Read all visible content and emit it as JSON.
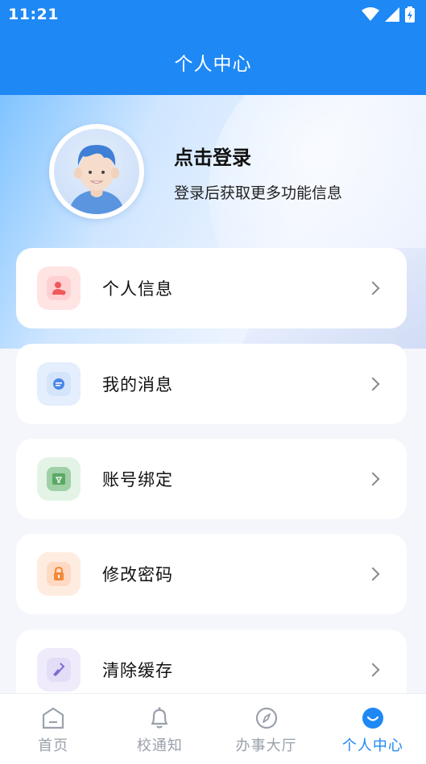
{
  "status_bar": {
    "time": "11:21"
  },
  "header": {
    "title": "个人中心"
  },
  "profile": {
    "login_title": "点击登录",
    "login_subtitle": "登录后获取更多功能信息"
  },
  "menu": [
    {
      "label": "个人信息",
      "icon": "user-icon"
    },
    {
      "label": "我的消息",
      "icon": "message-icon"
    },
    {
      "label": "账号绑定",
      "icon": "link-icon"
    },
    {
      "label": "修改密码",
      "icon": "lock-icon"
    },
    {
      "label": "清除缓存",
      "icon": "broom-icon"
    }
  ],
  "tabs": [
    {
      "label": "首页",
      "icon": "home-icon"
    },
    {
      "label": "校通知",
      "icon": "bell-icon"
    },
    {
      "label": "办事大厅",
      "icon": "compass-icon"
    },
    {
      "label": "个人中心",
      "icon": "smile-icon",
      "active": true
    }
  ],
  "colors": {
    "primary": "#1e88f5",
    "tab_inactive": "#9aa1ab"
  }
}
